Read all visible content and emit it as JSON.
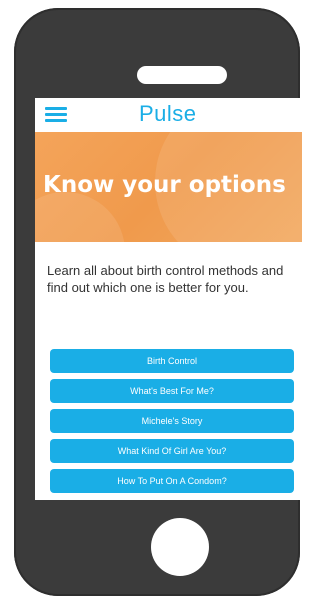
{
  "app": {
    "title": "Pulse",
    "accent_color": "#1aaee6",
    "menu_icon": "hamburger-menu-icon"
  },
  "banner": {
    "heading": "Know your options",
    "background_color": "#f09a4c"
  },
  "intro": {
    "text": "Learn all about birth control methods and find out which one is better for you."
  },
  "menu": {
    "items": [
      {
        "label": "Birth Control"
      },
      {
        "label": "What's Best For Me?"
      },
      {
        "label": "Michele's Story"
      },
      {
        "label": "What Kind Of Girl Are You?"
      },
      {
        "label": "How To Put On A Condom?"
      }
    ]
  },
  "device": {
    "frame_color": "#3b3b3b"
  }
}
